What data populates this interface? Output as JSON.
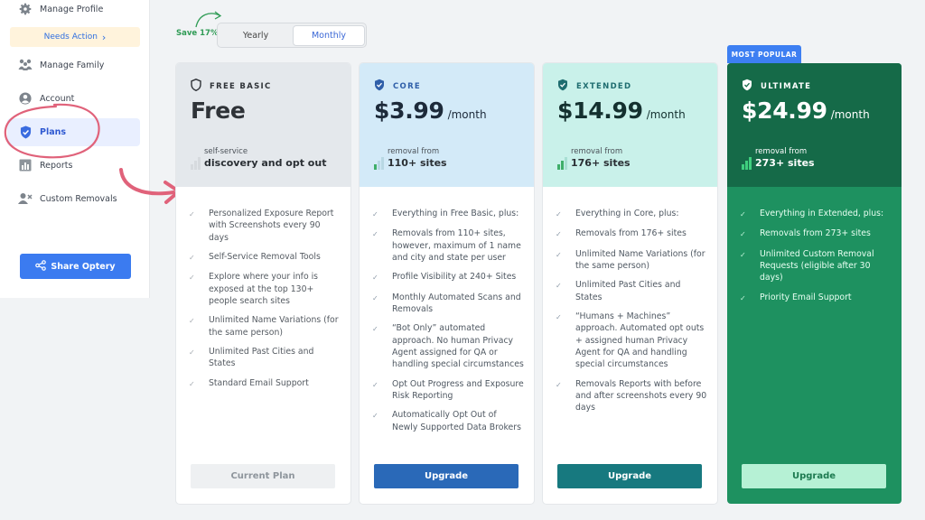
{
  "sidebar": {
    "manage_profile": "Manage Profile",
    "needs_action": "Needs Action",
    "manage_family": "Manage Family",
    "account": "Account",
    "plans": "Plans",
    "reports": "Reports",
    "custom_removals": "Custom Removals",
    "share_button": "Share Optery"
  },
  "billing": {
    "save_label": "Save 17%",
    "yearly_label": "Yearly",
    "monthly_label": "Monthly",
    "selected": "Monthly"
  },
  "most_popular": "MOST POPULAR",
  "plans": [
    {
      "name": "FREE BASIC",
      "price": "Free",
      "period": "",
      "stat_small": "self-service",
      "stat_big": "discovery and opt out",
      "features": [
        "Personalized Exposure Report with Screenshots every 90 days",
        "Self-Service Removal Tools",
        "Explore where your info is exposed at the top 130+ people search sites",
        "Unlimited Name Variations (for the same person)",
        "Unlimited Past Cities and States",
        "Standard Email Support"
      ],
      "button": "Current Plan"
    },
    {
      "name": "CORE",
      "price": "$3.99",
      "period": "/month",
      "stat_small": "removal from",
      "stat_big": "110+ sites",
      "features": [
        "Everything in Free Basic, plus:",
        "Removals from 110+ sites, however, maximum of 1 name and city and state per user",
        "Profile Visibility at 240+ Sites",
        "Monthly Automated Scans and Removals",
        "“Bot Only” automated approach. No human Privacy Agent assigned for QA or handling special circumstances",
        "Opt Out Progress and Exposure Risk Reporting",
        "Automatically Opt Out of Newly Supported Data Brokers"
      ],
      "button": "Upgrade"
    },
    {
      "name": "EXTENDED",
      "price": "$14.99",
      "period": "/month",
      "stat_small": "removal from",
      "stat_big": "176+ sites",
      "features": [
        "Everything in Core, plus:",
        "Removals from 176+ sites",
        "Unlimited Name Variations (for the same person)",
        "Unlimited Past Cities and States",
        "“Humans + Machines” approach. Automated opt outs + assigned human Privacy Agent for QA and handling special circumstances",
        "Removals Reports with before and after screenshots every 90 days"
      ],
      "button": "Upgrade"
    },
    {
      "name": "ULTIMATE",
      "price": "$24.99",
      "period": "/month",
      "stat_small": "removal from",
      "stat_big": "273+ sites",
      "features": [
        "Everything in Extended, plus:",
        "Removals from 273+ sites",
        "Unlimited Custom Removal Requests (eligible after 30 days)",
        "Priority Email Support"
      ],
      "button": "Upgrade"
    }
  ],
  "colors": {
    "free_header": "#e4e8ec",
    "core_header": "#d3eaf8",
    "extended_header": "#c9f1ea",
    "ultimate_header": "#156a48",
    "ultimate_body": "#1e9160",
    "core_button": "#2a69b8",
    "extended_button": "#17797f",
    "ultimate_button": "#b6f1d5",
    "popular_badge": "#3d7ff2",
    "annotation": "#e0627a"
  }
}
